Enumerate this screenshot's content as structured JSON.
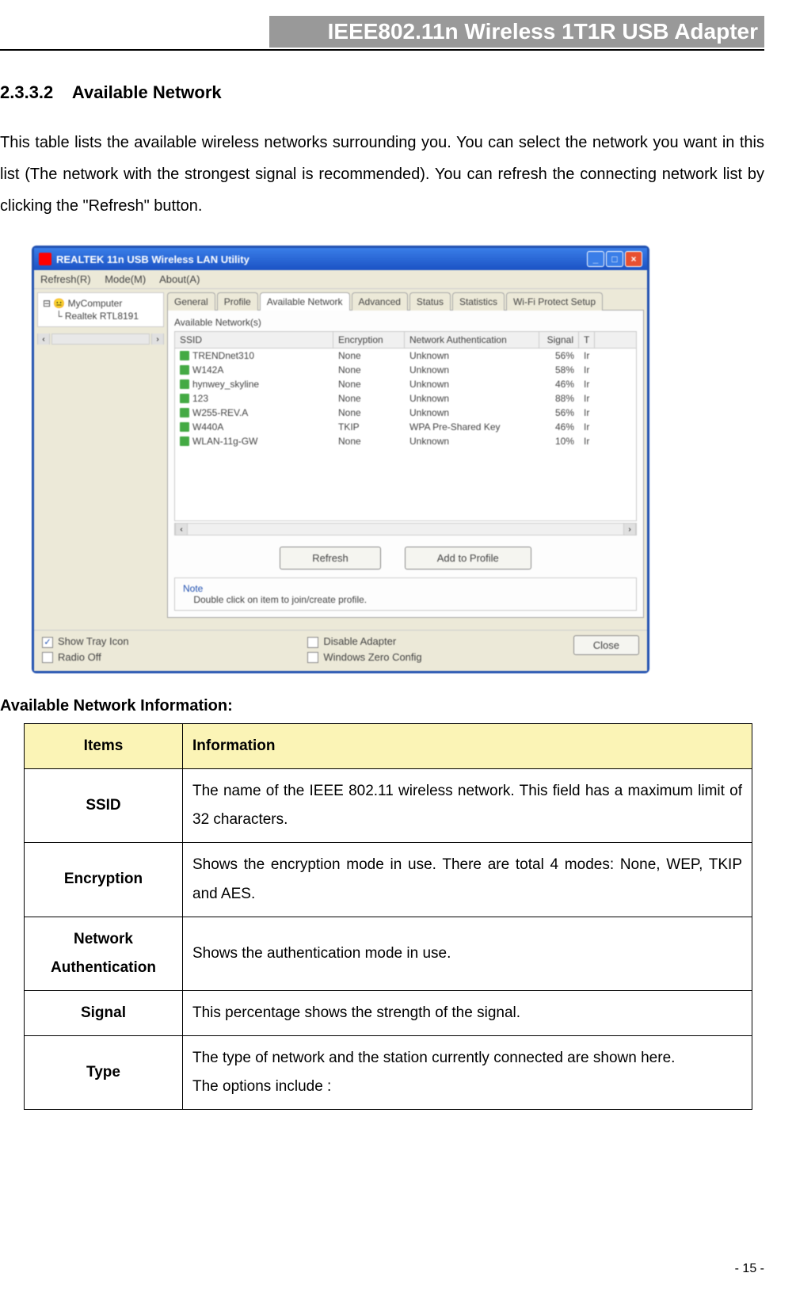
{
  "header": {
    "title": "IEEE802.11n Wireless 1T1R USB Adapter"
  },
  "section": {
    "number": "2.3.3.2",
    "title": "Available Network"
  },
  "body_paragraph": "This table lists the available wireless networks surrounding you. You can select the network you want in this list (The network with the strongest signal is recommended). You can refresh the connecting network list by clicking the \"Refresh\" button.",
  "screenshot": {
    "window_title": "REALTEK 11n USB Wireless LAN Utility",
    "menu": {
      "refresh": "Refresh(R)",
      "mode": "Mode(M)",
      "about": "About(A)"
    },
    "tree": {
      "root": "MyComputer",
      "child": "Realtek RTL8191"
    },
    "tabs": {
      "general": "General",
      "profile": "Profile",
      "available_network": "Available Network",
      "advanced": "Advanced",
      "status": "Status",
      "statistics": "Statistics",
      "wps": "Wi-Fi Protect Setup"
    },
    "group_label": "Available Network(s)",
    "columns": {
      "ssid": "SSID",
      "encryption": "Encryption",
      "network_auth": "Network Authentication",
      "signal": "Signal",
      "type_short": "T"
    },
    "rows": [
      {
        "ssid": "TRENDnet310",
        "enc": "None",
        "auth": "Unknown",
        "sig": "56%",
        "t": "Ir"
      },
      {
        "ssid": "W142A",
        "enc": "None",
        "auth": "Unknown",
        "sig": "58%",
        "t": "Ir"
      },
      {
        "ssid": "hynwey_skyline",
        "enc": "None",
        "auth": "Unknown",
        "sig": "46%",
        "t": "Ir"
      },
      {
        "ssid": "123",
        "enc": "None",
        "auth": "Unknown",
        "sig": "88%",
        "t": "Ir"
      },
      {
        "ssid": "W255-REV.A",
        "enc": "None",
        "auth": "Unknown",
        "sig": "56%",
        "t": "Ir"
      },
      {
        "ssid": "W440A",
        "enc": "TKIP",
        "auth": "WPA Pre-Shared Key",
        "sig": "46%",
        "t": "Ir"
      },
      {
        "ssid": "WLAN-11g-GW",
        "enc": "None",
        "auth": "Unknown",
        "sig": "10%",
        "t": "Ir"
      }
    ],
    "buttons": {
      "refresh": "Refresh",
      "add_to_profile": "Add to Profile"
    },
    "note": {
      "label": "Note",
      "text": "Double click on item to join/create profile."
    },
    "bottom": {
      "show_tray_icon": "Show Tray Icon",
      "radio_off": "Radio Off",
      "disable_adapter": "Disable Adapter",
      "windows_zero_config": "Windows Zero Config",
      "close": "Close"
    }
  },
  "sub_heading": "Available Network Information:",
  "info_table": {
    "head": {
      "items": "Items",
      "information": "Information"
    },
    "rows": [
      {
        "item": "SSID",
        "info": "The name of the IEEE 802.11 wireless network. This field has a maximum limit of 32 characters."
      },
      {
        "item": "Encryption",
        "info": "Shows the encryption mode in use. There are total 4 modes: None, WEP, TKIP and AES."
      },
      {
        "item": "Network Authentication",
        "info": "Shows the authentication mode in use."
      },
      {
        "item": "Signal",
        "info": "This percentage shows the strength of the signal."
      },
      {
        "item": "Type",
        "info": "The type of network and the station currently connected are shown here.\nThe options include :"
      }
    ]
  },
  "page_number": "- 15 -"
}
